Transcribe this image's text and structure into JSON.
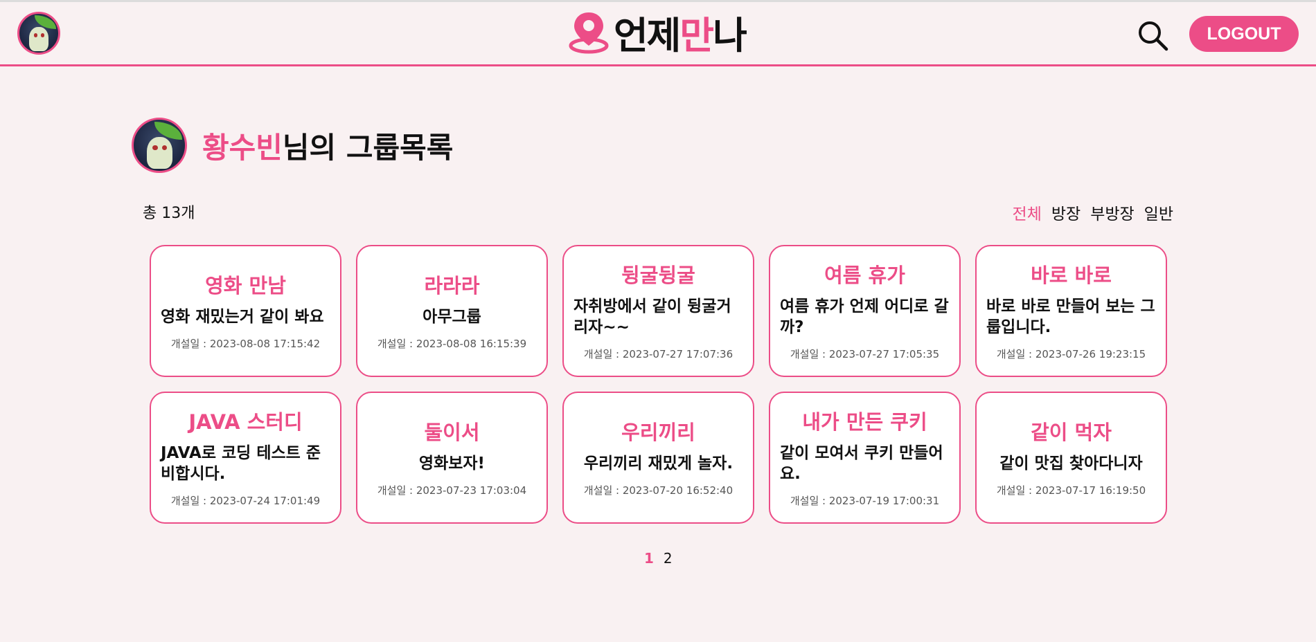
{
  "header": {
    "logo": {
      "part1": "언제",
      "part2": "만",
      "part3": "나"
    },
    "logout_label": "LOGOUT"
  },
  "page": {
    "user_name": "황수빈",
    "title_suffix": "님의 그룹목록",
    "total": "총 13개"
  },
  "filters": [
    {
      "label": "전체",
      "active": true
    },
    {
      "label": "방장",
      "active": false
    },
    {
      "label": "부방장",
      "active": false
    },
    {
      "label": "일반",
      "active": false
    }
  ],
  "groups": [
    {
      "name": "영화 만남",
      "desc": "영화 재밌는거 같이 봐요",
      "date": "개설일 : 2023-08-08 17:15:42"
    },
    {
      "name": "라라라",
      "desc": "아무그룹",
      "date": "개설일 : 2023-08-08 16:15:39"
    },
    {
      "name": "뒹굴뒹굴",
      "desc": "자취방에서 같이 뒹굴거리자~~",
      "date": "개설일 : 2023-07-27 17:07:36"
    },
    {
      "name": "여름 휴가",
      "desc": "여름 휴가 언제 어디로 갈까?",
      "date": "개설일 : 2023-07-27 17:05:35"
    },
    {
      "name": "바로 바로",
      "desc": "바로 바로 만들어 보는 그룹입니다.",
      "date": "개설일 : 2023-07-26 19:23:15"
    },
    {
      "name": "JAVA 스터디",
      "desc": "JAVA로 코딩 테스트 준비합시다.",
      "date": "개설일 : 2023-07-24 17:01:49"
    },
    {
      "name": "둘이서",
      "desc": "영화보자!",
      "date": "개설일 : 2023-07-23 17:03:04"
    },
    {
      "name": "우리끼리",
      "desc": "우리끼리 재밌게 놀자.",
      "date": "개설일 : 2023-07-20 16:52:40"
    },
    {
      "name": "내가 만든 쿠키",
      "desc": "같이 모여서 쿠키 만들어요.",
      "date": "개설일 : 2023-07-19 17:00:31"
    },
    {
      "name": "같이 먹자",
      "desc": "같이 맛집 찾아다니자",
      "date": "개설일 : 2023-07-17 16:19:50"
    }
  ],
  "pagination": [
    {
      "label": "1",
      "active": true
    },
    {
      "label": "2",
      "active": false
    }
  ],
  "colors": {
    "accent": "#ec4d87",
    "background": "#f9f1f2"
  }
}
